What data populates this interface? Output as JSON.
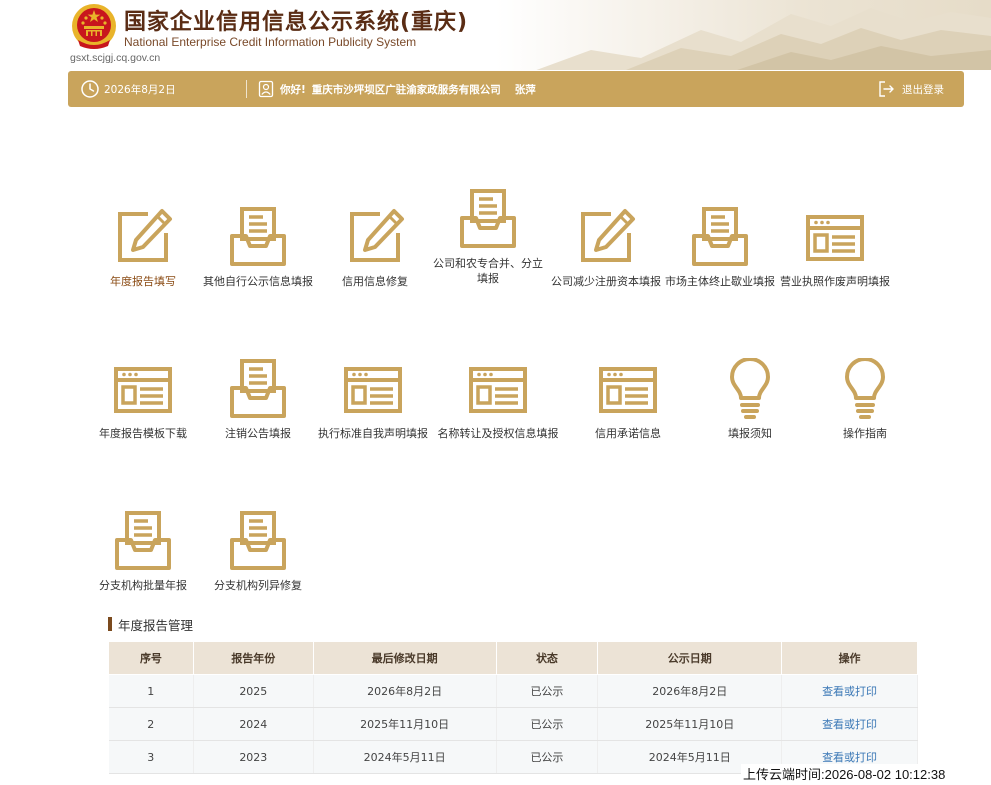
{
  "header": {
    "title": "国家企业信用信息公示系统(重庆)",
    "subtitle": "National Enterprise Credit Information Publicity System",
    "url": "gsxt.scjgj.cq.gov.cn"
  },
  "topbar": {
    "date": "2026年8月2日",
    "greeting": "你好!",
    "company": "重庆市沙坪坝区广驻渝家政服务有限公司",
    "user": "张萍",
    "logout": "退出登录"
  },
  "tiles": [
    {
      "label": "年度报告填写",
      "icon": "edit-icon"
    },
    {
      "label": "其他自行公示信息填报",
      "icon": "tray-icon"
    },
    {
      "label": "信用信息修复",
      "icon": "edit-icon"
    },
    {
      "label": "公司和农专合并、分立",
      "label2": "填报",
      "icon": "tray-icon"
    },
    {
      "label": "公司减少注册资本填报",
      "icon": "edit-icon"
    },
    {
      "label": "市场主体终止歇业填报",
      "icon": "tray-icon"
    },
    {
      "label": "营业执照作废声明填报",
      "icon": "window-icon"
    },
    {
      "label": "年度报告模板下载",
      "icon": "window-icon"
    },
    {
      "label": "注销公告填报",
      "icon": "tray-icon"
    },
    {
      "label": "执行标准自我声明填报",
      "icon": "window-icon"
    },
    {
      "label": "名称转让及授权信息填报",
      "icon": "window-icon"
    },
    {
      "label": "信用承诺信息",
      "icon": "window-icon"
    },
    {
      "label": "填报须知",
      "icon": "bulb-icon"
    },
    {
      "label": "操作指南",
      "icon": "bulb-icon"
    },
    {
      "label": "分支机构批量年报",
      "icon": "tray-icon"
    },
    {
      "label": "分支机构列异修复",
      "icon": "tray-icon"
    }
  ],
  "section": {
    "title": "年度报告管理"
  },
  "table": {
    "headers": [
      "序号",
      "报告年份",
      "最后修改日期",
      "状态",
      "公示日期",
      "操作"
    ],
    "rows": [
      [
        "1",
        "2025",
        "2026年8月2日",
        "已公示",
        "2026年8月2日",
        "查看或打印"
      ],
      [
        "2",
        "2024",
        "2025年11月10日",
        "已公示",
        "2025年11月10日",
        "查看或打印"
      ],
      [
        "3",
        "2023",
        "2024年5月11日",
        "已公示",
        "2024年5月11日",
        "查看或打印"
      ]
    ]
  },
  "upload_time": "上传云端时间:2026-08-02 10:12:38",
  "colors": {
    "accent": "#c9a45c",
    "icon": "#c9a45c",
    "title": "#5a2c14",
    "link": "#3b78b6",
    "table_header": "#ece3d6",
    "emblem_red": "#c8161d",
    "emblem_gold": "#e9b42a"
  }
}
